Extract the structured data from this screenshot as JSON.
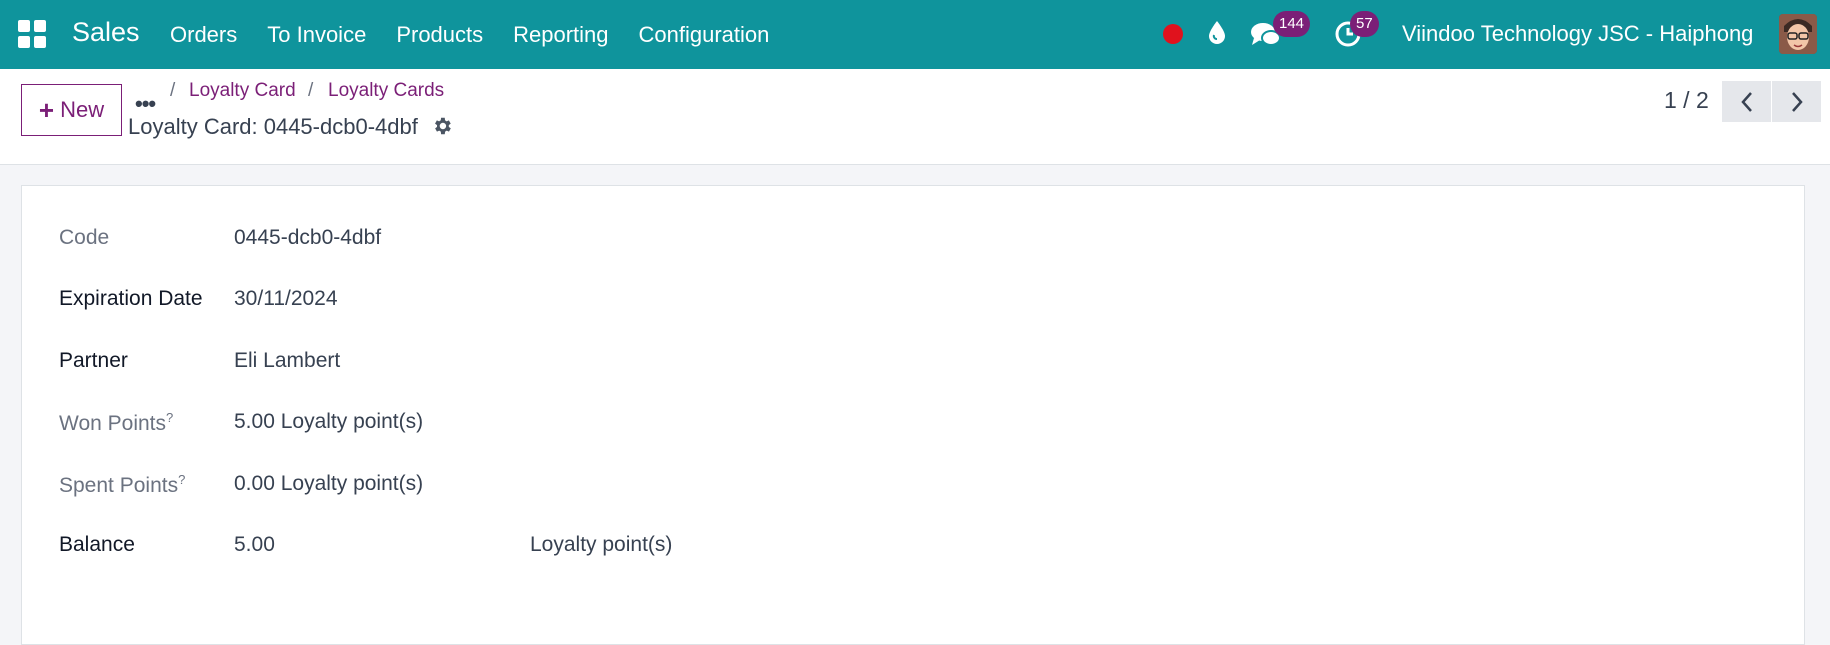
{
  "navbar": {
    "app_name": "Sales",
    "menu": [
      "Orders",
      "To Invoice",
      "Products",
      "Reporting",
      "Configuration"
    ],
    "messages_count": "144",
    "activities_count": "57",
    "company": "Viindoo Technology JSC - Haiphong",
    "record_color": "#e0121d"
  },
  "control": {
    "new_label": "New",
    "breadcrumb_more": "•••",
    "breadcrumb": [
      "Loyalty Card",
      "Loyalty Cards"
    ],
    "record_title": "Loyalty Card: 0445-dcb0-4dbf",
    "pager": "1 / 2"
  },
  "form": {
    "fields": [
      {
        "label": "Code",
        "value": "0445-dcb0-4dbf"
      },
      {
        "label": "Expiration Date",
        "value": "30/11/2024"
      },
      {
        "label": "Partner",
        "value": "Eli Lambert"
      },
      {
        "label": "Won Points",
        "help": "?",
        "value": "5.00 Loyalty point(s)"
      },
      {
        "label": "Spent Points",
        "help": "?",
        "value": "0.00 Loyalty point(s)"
      },
      {
        "label": "Balance",
        "value": "5.00",
        "unit": "Loyalty point(s)"
      }
    ]
  },
  "colors": {
    "navbar": "#0f949c",
    "accent": "#7b1f77"
  },
  "icons": [
    "apps-grid-icon",
    "record-dot-icon",
    "drop-icon",
    "chat-icon",
    "clock-icon",
    "gear-icon",
    "chevron-left-icon",
    "chevron-right-icon",
    "plus-icon"
  ]
}
